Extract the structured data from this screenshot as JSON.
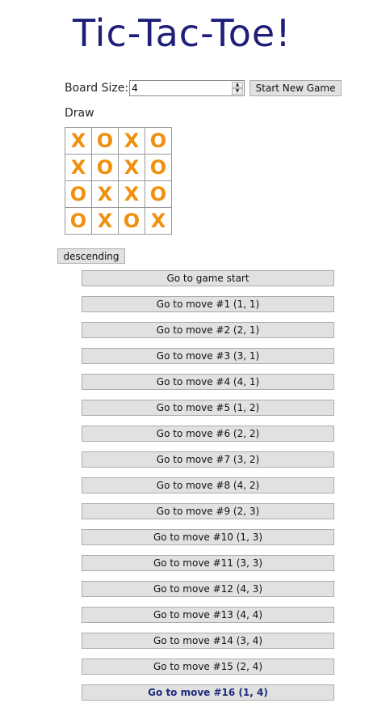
{
  "title": "Tic-Tac-Toe!",
  "controls": {
    "board_size_label": "Board Size:",
    "board_size_value": "4",
    "start_button": "Start New Game"
  },
  "status": "Draw",
  "board": [
    [
      "X",
      "O",
      "X",
      "O"
    ],
    [
      "X",
      "O",
      "X",
      "O"
    ],
    [
      "O",
      "X",
      "X",
      "O"
    ],
    [
      "O",
      "X",
      "O",
      "X"
    ]
  ],
  "sort_button": "descending",
  "moves": [
    "Go to game start",
    "Go to move #1 (1, 1)",
    "Go to move #2 (2, 1)",
    "Go to move #3 (3, 1)",
    "Go to move #4 (4, 1)",
    "Go to move #5 (1, 2)",
    "Go to move #6 (2, 2)",
    "Go to move #7 (3, 2)",
    "Go to move #8 (4, 2)",
    "Go to move #9 (2, 3)",
    "Go to move #10 (1, 3)",
    "Go to move #11 (3, 3)",
    "Go to move #12 (4, 3)",
    "Go to move #13 (4, 4)",
    "Go to move #14 (3, 4)",
    "Go to move #15 (2, 4)",
    "Go to move #16 (1, 4)"
  ],
  "current_move": 16,
  "colors": {
    "title": "#1f1f7a",
    "mark": "#f0900f",
    "current_move_text": "#1f2a7a",
    "button_bg": "#e1e1e1"
  }
}
